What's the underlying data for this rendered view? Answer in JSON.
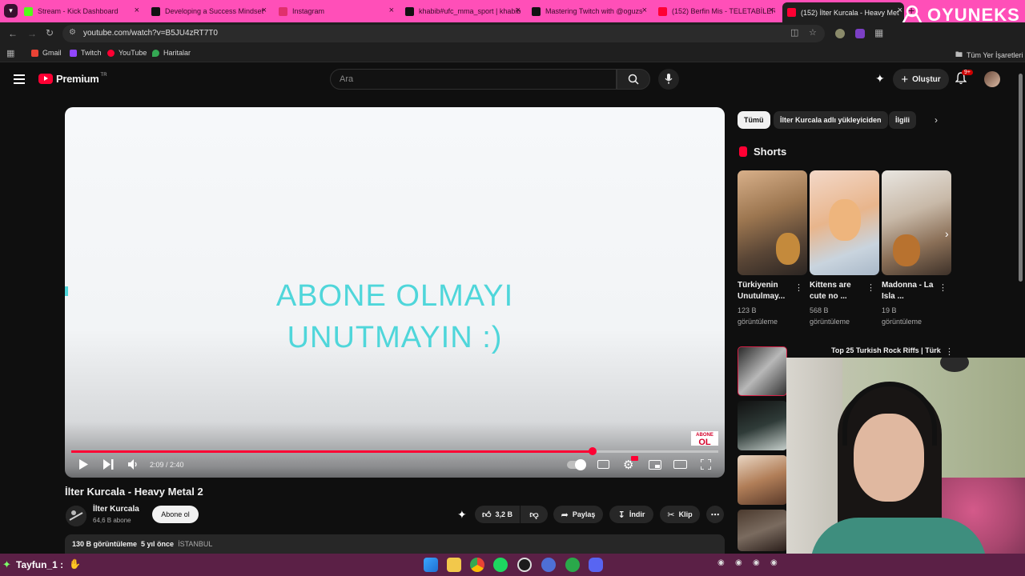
{
  "browser": {
    "tabs": [
      {
        "title": "Stream - Kick Dashboard",
        "color": "#53fc18"
      },
      {
        "title": "Developing a Success Mindset",
        "color": "#111111"
      },
      {
        "title": "Instagram",
        "color": "#e1306c"
      },
      {
        "title": "khabib#ufc_mma_sport | khabib",
        "color": "#111111"
      },
      {
        "title": "Mastering Twitch with @oguzs",
        "color": "#111111"
      },
      {
        "title": "(152) Berfin Mis - TELETABİLER",
        "color": "#ff0033"
      },
      {
        "title": "(152) İlter Kurcala - Heavy Met",
        "color": "#ff0033"
      }
    ],
    "url": "youtube.com/watch?v=B5JU4zRT7T0",
    "bookmarks": [
      {
        "label": "Gmail",
        "color": "#ea4335"
      },
      {
        "label": "Twitch",
        "color": "#9146ff"
      },
      {
        "label": "YouTube",
        "color": "#ff0033"
      },
      {
        "label": "Haritalar",
        "color": "#34a853"
      }
    ],
    "all_bookmarks": "Tüm Yer İşaretleri"
  },
  "overlay_logo": "OYUNEKS",
  "youtube": {
    "brand": "Premium",
    "region": "TR",
    "search_placeholder": "Ara",
    "create_label": "Oluştur",
    "notif_badge": "9+",
    "accent": "#ff0033"
  },
  "video": {
    "overlay_line1": "ABONE OLMAYI",
    "overlay_line2": "UNUTMAYIN :)",
    "badge_line1": "ABONE",
    "badge_line2": "OL",
    "current_time": "2:09",
    "duration": "2:40",
    "time_display": "2:09 / 2:40",
    "progress": 0.80625,
    "title": "İlter Kurcala - Heavy Metal 2",
    "channel": "İlter Kurcala",
    "subscribers": "64,6 B abone",
    "subscribe_label": "Abone ol",
    "likes": "3,2 B",
    "share_label": "Paylaş",
    "download_label": "İndir",
    "clip_label": "Klip",
    "views": "130 B görüntüleme",
    "age": "5 yıl önce",
    "location": "İSTANBUL"
  },
  "sidebar": {
    "chips": [
      "Tümü",
      "İlter Kurcala adlı yükleyiciden",
      "İlgili"
    ],
    "shorts_heading": "Shorts",
    "shorts": [
      {
        "title": "Türkiyenin Unutulmay...",
        "views": "123 B",
        "views_unit": "görüntüleme"
      },
      {
        "title": "Kittens are cute no ...",
        "views": "568 B",
        "views_unit": "görüntüleme"
      },
      {
        "title": "Madonna - La Isla ...",
        "views": "19 B",
        "views_unit": "görüntüleme"
      }
    ],
    "up_next": [
      {
        "title": "Top 25 Turkish Rock Riffs | Türk"
      }
    ]
  },
  "taskbar": {
    "user": "Tayfun_1 :"
  }
}
